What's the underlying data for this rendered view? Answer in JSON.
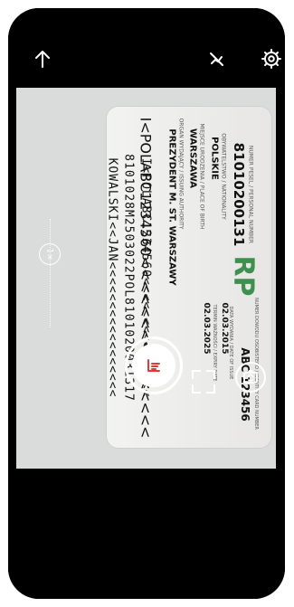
{
  "card": {
    "number_label": "NUMER PESEL / PERSONAL NUMBER",
    "pesel": "81010200131",
    "citizenship_label": "OBYWATELSTWO / NATIONALITY",
    "citizenship": "POLSKIE",
    "birthplace_label": "MIEJSCE URODZENIA / PLACE OF BIRTH",
    "birthplace": "WARSZAWA",
    "authority_label": "ORGAN WYDAJĄCY / ISSUING AUTHORITY",
    "authority": "PREZYDENT M. ST. WARSZAWY",
    "doc_no_label": "NUMER DOWODU OSOBISTEGO / IDENTITY CARD NUMBER",
    "doc_no": "ABC 123456",
    "issue_label": "DATA WYDANIA / DATE OF ISSUE",
    "issue_date": "02.03.2015",
    "expiry_label": "TERMIN WAŻNOŚCI / EXPIRY DATE",
    "expiry_date": "02.03.2025",
    "rp": "RP",
    "mrz1": "I<POLABC1234560<<<<<<<<<<<<<<<",
    "mrz2": "8101028M2503022POL8101020031317",
    "mrz3": "KOWALSKI<<JAN<<<<<<<<<<<<<<<<<"
  },
  "controls": {
    "zoom": "1×"
  }
}
